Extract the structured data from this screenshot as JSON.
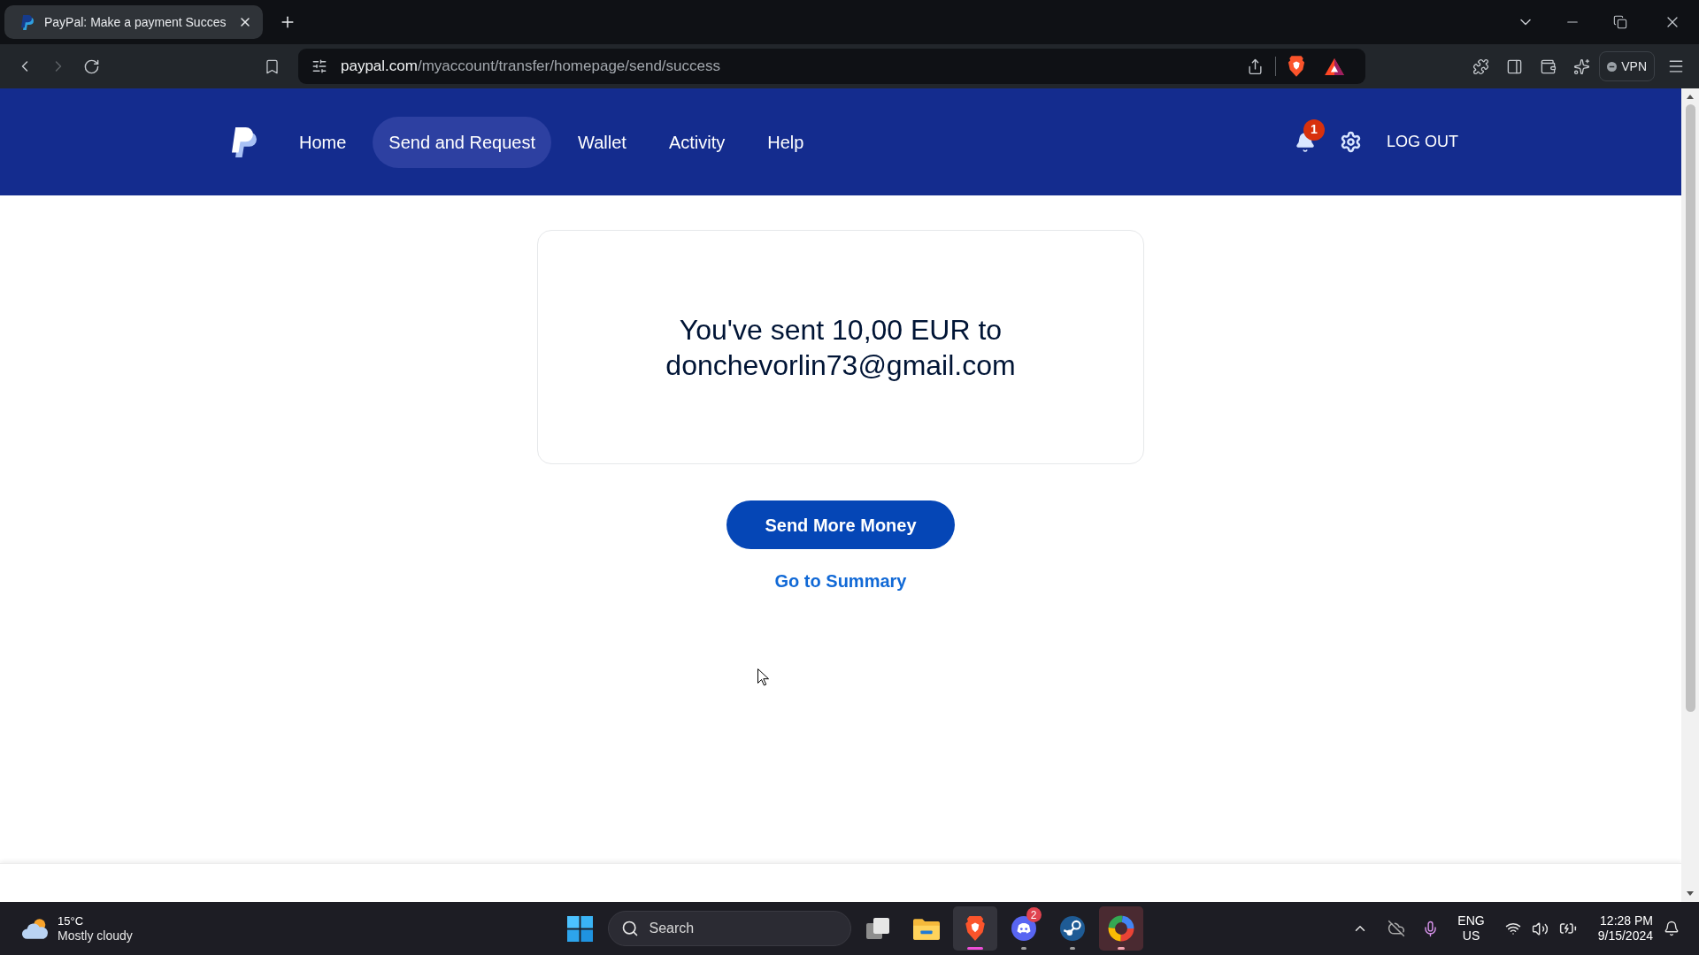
{
  "browser": {
    "tabs": [
      {
        "title": "PayPal: Make a payment Succes",
        "selected": true
      }
    ],
    "forward_disabled": true,
    "address": {
      "host": "paypal.com",
      "path": "/myaccount/transfer/homepage/send/success"
    },
    "vpn": {
      "label": "VPN",
      "connected": false
    }
  },
  "navbar": {
    "items": [
      {
        "label": "Home",
        "selected": false
      },
      {
        "label": "Send and Request",
        "selected": true
      },
      {
        "label": "Wallet",
        "selected": false
      },
      {
        "label": "Activity",
        "selected": false
      },
      {
        "label": "Help",
        "selected": false
      }
    ],
    "notifications": "1",
    "logout": "LOG OUT"
  },
  "confirmation": {
    "message": "You've sent 10,00 EUR to donchevorlin73@gmail.com"
  },
  "actions": [
    {
      "kind": "primary",
      "label": "Send More Money"
    },
    {
      "kind": "link",
      "label": "Go to Summary"
    }
  ],
  "taskbar": {
    "weather": {
      "temperature": "15°C",
      "condition": "Mostly cloudy"
    },
    "search": {
      "placeholder": "Search"
    },
    "apps": [
      {
        "kind": "task-view",
        "running": false,
        "selected": false,
        "attention": false
      },
      {
        "kind": "file-explorer",
        "running": false,
        "selected": false,
        "attention": false
      },
      {
        "kind": "brave",
        "running": true,
        "selected": true,
        "attention": false
      },
      {
        "kind": "discord",
        "running": true,
        "selected": false,
        "attention": false,
        "badge": "2"
      },
      {
        "kind": "steam",
        "running": true,
        "selected": false,
        "attention": false
      },
      {
        "kind": "ring",
        "running": true,
        "selected": false,
        "attention": true
      }
    ],
    "tray": {
      "language": "ENG",
      "region": "US",
      "time": "12:28 PM",
      "date": "9/15/2024"
    }
  }
}
